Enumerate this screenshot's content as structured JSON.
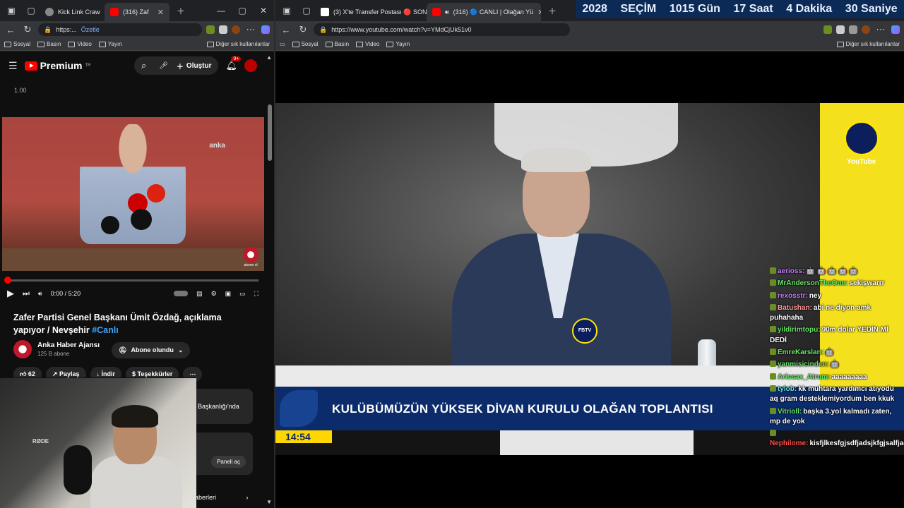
{
  "left_window": {
    "tabs": [
      {
        "label": "Kick Link Craw",
        "active": false
      },
      {
        "label": "(316) Zaf",
        "active": true
      }
    ],
    "address": {
      "url": "https:...",
      "action": "Özetle"
    },
    "bookmarks": [
      "Sosyal",
      "Basın",
      "Video",
      "Yayın"
    ],
    "bookmarks_other": "Diğer sık kullanılanlar"
  },
  "right_window": {
    "tabs": [
      {
        "label": "(3) X'te Transfer Postası 🔴 SON",
        "active": false
      },
      {
        "label": "(316) 🔵 CANLI | Olağan Yü",
        "active": true
      }
    ],
    "address": {
      "url": "https://www.youtube.com/watch?v=YMdCjUk51v0"
    },
    "bookmarks": [
      "Sosyal",
      "Basın",
      "Video",
      "Yayın"
    ],
    "bookmarks_other": "Diğer sık kullanılanlar"
  },
  "counter": {
    "year": "2028",
    "label": "SEÇİM",
    "days": "1015 Gün",
    "hours": "17 Saat",
    "minutes": "4 Dakika",
    "seconds": "30 Saniye"
  },
  "youtube": {
    "logo": "Premium",
    "logo_region": "TR",
    "create_label": "Oluştur",
    "notif_count": "9+",
    "speed": "1.00",
    "video_watermark": "anka",
    "video_corner": "abone ol",
    "progress": 0.0,
    "time": "0:00 / 5:20",
    "title": "Zafer Partisi Genel Başkanı Ümit Özdağ, açıklama yapıyor / Nevşehir",
    "title_tag": "#Canlı",
    "channel": "Anka Haber Ajansı",
    "subscribers": "125 B abone",
    "subscribe_label": "Abone olundu",
    "like_count": "62",
    "share_label": "Paylaş",
    "download_label": "İndir",
    "thanks_label": "Teşekkürler",
    "side_text": "Başkanlığı'nda",
    "panel_button": "Paneli aç",
    "side_bottom": "aberleri"
  },
  "webcam": {
    "mic_brand": "RØDE"
  },
  "live": {
    "banner": "KULÜBÜMÜZÜN YÜKSEK DİVAN KURULU OLAĞAN TOPLANTISI",
    "clock": "14:54",
    "channel_badge": "YouTube",
    "mic_badge": "FBTV"
  },
  "chat": [
    {
      "user": "aerioss:",
      "text": "🤖 🤖 🤖 🤖 🤖",
      "color": "#c27cff"
    },
    {
      "user": "MrAndersonTheOne:",
      "text": "sekişwarrr",
      "color": "#6be36b"
    },
    {
      "user": "rexosstr:",
      "text": "ney",
      "color": "#c27cff"
    },
    {
      "user": "Batushan:",
      "text": "abi ne diyon amk puhahaha",
      "color": "#ff9a9a"
    },
    {
      "user": "yildirimtopu:",
      "text": "90m dolar YEDİN Mİ DEDİ",
      "color": "#6be36b"
    },
    {
      "user": "EmreKarslan:",
      "text": "🤖",
      "color": "#6be36b"
    },
    {
      "user": "yanmisicinden:",
      "text": "🤖",
      "color": "#6be36b"
    },
    {
      "user": "Arissax_Atrum:",
      "text": "aaaaaaaaa",
      "color": "#6be36b"
    },
    {
      "user": "tylob:",
      "text": "kk muhtara yardımcı atıyodu aq gram desteklemiyordum ben kkuk",
      "color": "#6be3e3"
    },
    {
      "user": "Vitrioll:",
      "text": "başka 3.yol kalmadı zaten, mp de yok",
      "color": "#6be36b"
    },
    {
      "user": "Nephilome:",
      "text": "kisfjlkesfgjsdfjadsjkfgjsalfjad",
      "color": "#ff4d4d"
    }
  ]
}
